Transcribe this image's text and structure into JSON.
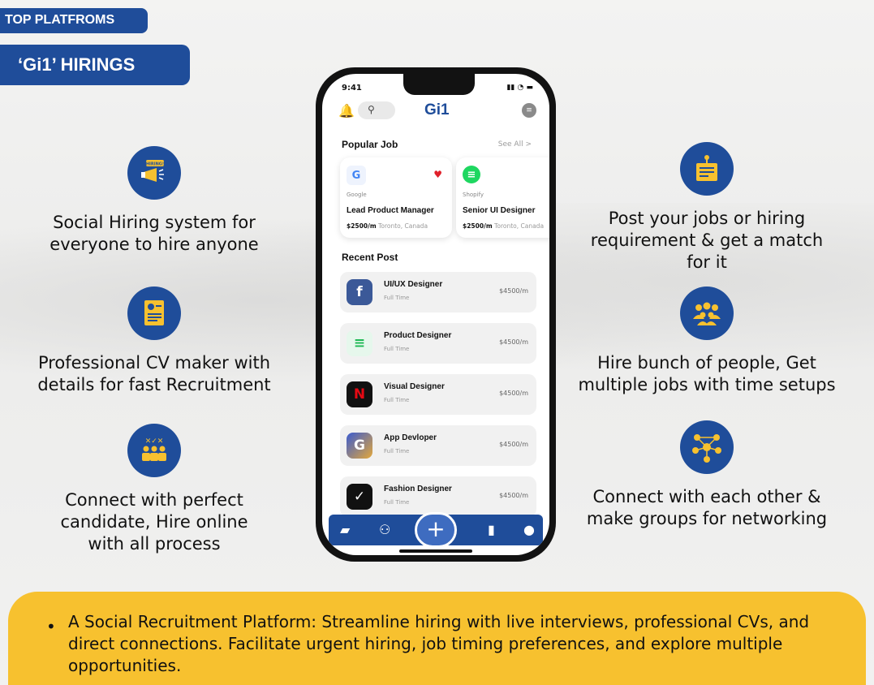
{
  "header": {
    "top_tag": "TOP PLATFROMS",
    "sub_tag": "‘Gi1’ HIRINGS"
  },
  "features_left": [
    {
      "icon": "megaphone-hiring-icon",
      "badge": "HIRING!",
      "text": "Social Hiring system for everyone to hire anyone"
    },
    {
      "icon": "cv-document-icon",
      "text": "Professional CV maker with details for fast Recruitment"
    },
    {
      "icon": "candidates-check-icon",
      "text": "Connect with perfect candidate, Hire online with all process"
    }
  ],
  "features_right": [
    {
      "icon": "job-post-icon",
      "text": "Post your jobs or hiring requirement & get a match for it"
    },
    {
      "icon": "group-people-icon",
      "text": "Hire bunch of people, Get multiple jobs with time setups"
    },
    {
      "icon": "network-icon",
      "text": "Connect with each other & make groups for networking"
    }
  ],
  "phone": {
    "time": "9:41",
    "app_title": "Gi1",
    "popular_title": "Popular Job",
    "see_all": "See All >",
    "popular_jobs": [
      {
        "logo": "G",
        "company": "Google",
        "role": "Lead Product Manager",
        "pay": "$2500/m",
        "location": "Toronto, Canada",
        "logo_color": "#4285f4",
        "logo_bg": "#eef3fd"
      },
      {
        "logo": "≡",
        "company": "Shopify",
        "role": "Senior UI Designer",
        "pay": "$2500/m",
        "location": "Toronto, Canada",
        "logo_color": "#ffffff",
        "logo_bg": "#1ed760"
      }
    ],
    "recent_title": "Recent Post",
    "recent_posts": [
      {
        "logo": "f",
        "title": "UI/UX Designer",
        "type": "Full Time",
        "pay": "$4500/m",
        "logo_bg": "#3b5998",
        "logo_color": "#ffffff"
      },
      {
        "logo": "≡",
        "title": "Product Designer",
        "type": "Full Time",
        "pay": "$4500/m",
        "logo_bg": "#e6f7ec",
        "logo_color": "#1db954"
      },
      {
        "logo": "N",
        "title": "Visual Designer",
        "type": "Full Time",
        "pay": "$4500/m",
        "logo_bg": "#111111",
        "logo_color": "#e50914"
      },
      {
        "logo": "G",
        "title": "App Devloper",
        "type": "Full Time",
        "pay": "$4500/m",
        "logo_bg": "#3a5bd0",
        "logo_color": "#ffffff"
      },
      {
        "logo": "✓",
        "title": "Fashion Designer",
        "type": "Full Time",
        "pay": "$4500/m",
        "logo_bg": "#111111",
        "logo_color": "#ffffff"
      }
    ],
    "nav": [
      "briefcase-icon",
      "people-icon",
      "plus-icon",
      "bookmark-icon",
      "profile-icon"
    ]
  },
  "summary": {
    "bullet": "•",
    "text": "A Social Recruitment Platform: Streamline hiring with live interviews, professional CVs, and direct connections. Facilitate urgent hiring, job timing preferences, and explore multiple opportunities."
  },
  "colors": {
    "brand_blue": "#1f4d9a",
    "accent_yellow": "#f7c12f"
  }
}
